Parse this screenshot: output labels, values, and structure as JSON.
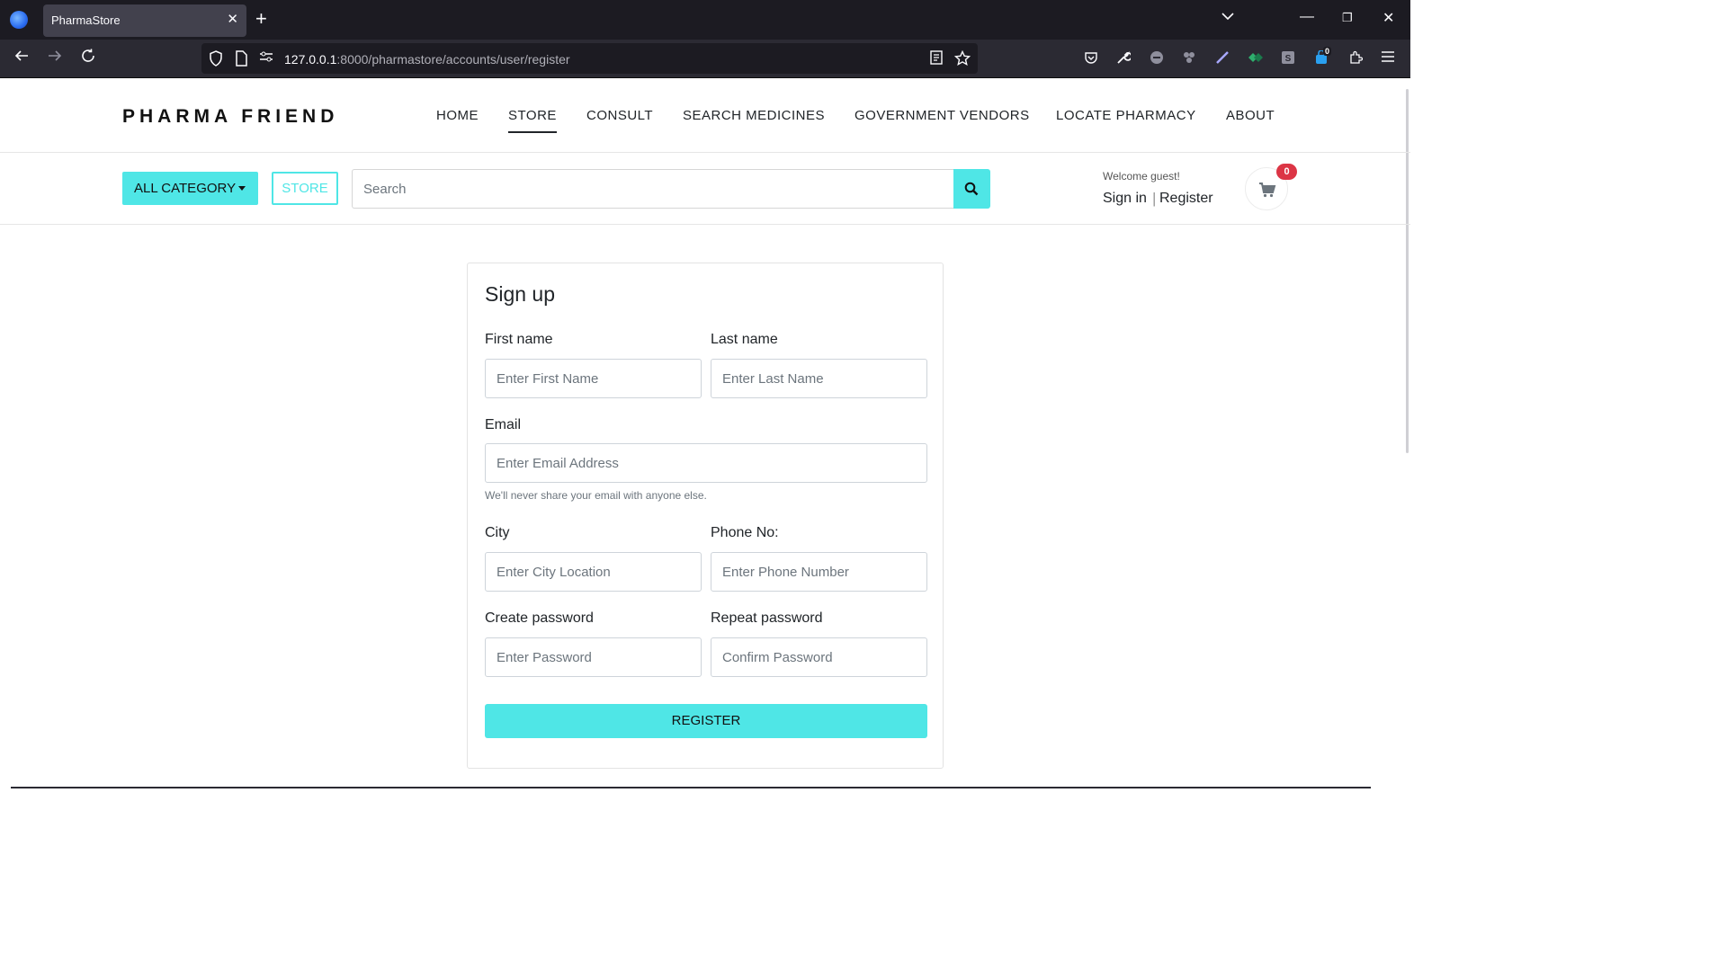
{
  "browser": {
    "tab_title": "PharmaStore",
    "url_host": "127.0.0.1",
    "url_rest": ":8000/pharmastore/accounts/user/register",
    "ext_badge": "0"
  },
  "brand": "PHARMA FRIEND",
  "nav": {
    "items": [
      "HOME",
      "STORE",
      "CONSULT",
      "SEARCH MEDICINES",
      "GOVERNMENT VENDORS",
      "LOCATE PHARMACY",
      "ABOUT"
    ],
    "active": "STORE"
  },
  "toolbar": {
    "category_label": "ALL CATEGORY",
    "store_label": "STORE",
    "search_placeholder": "Search",
    "welcome": "Welcome guest!",
    "signin": "Sign in",
    "register": "Register",
    "cart_count": "0"
  },
  "form": {
    "title": "Sign up",
    "first_name_label": "First name",
    "first_name_placeholder": "Enter First Name",
    "last_name_label": "Last name",
    "last_name_placeholder": "Enter Last Name",
    "email_label": "Email",
    "email_placeholder": "Enter Email Address",
    "email_help": "We'll never share your email with anyone else.",
    "city_label": "City",
    "city_placeholder": "Enter City Location",
    "phone_label": "Phone No:",
    "phone_placeholder": "Enter Phone Number",
    "password_label": "Create password",
    "password_placeholder": "Enter Password",
    "repeat_label": "Repeat password",
    "repeat_placeholder": "Confirm Password",
    "submit": "REGISTER"
  },
  "colors": {
    "accent": "#4fe6e6",
    "badge": "#dc3545",
    "chrome_dark": "#1c1b22"
  },
  "icons": [
    "firefox-icon",
    "close-icon",
    "plus-icon",
    "back-icon",
    "forward-icon",
    "reload-icon",
    "shield-icon",
    "page-icon",
    "permissions-icon",
    "reader-icon",
    "star-icon",
    "pocket-icon",
    "wrench-icon",
    "extension-icon",
    "menu-icon",
    "search-icon",
    "cart-icon"
  ]
}
